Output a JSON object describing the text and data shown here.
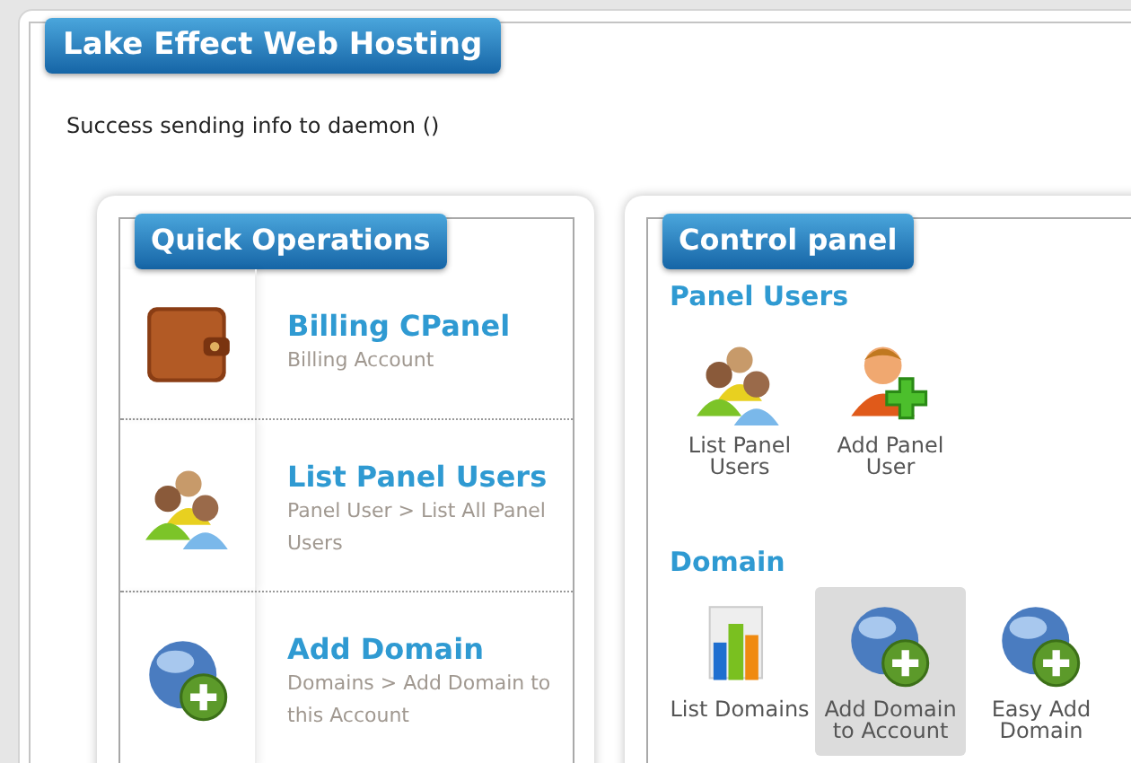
{
  "page_title": "Lake Effect Web Hosting",
  "message": "Success sending info to daemon ()",
  "quick_operations": {
    "title": "Quick Operations",
    "items": [
      {
        "kind": "wallet",
        "title": "Billing CPanel",
        "subtitle": "Billing Account"
      },
      {
        "kind": "users",
        "title": "List Panel Users",
        "subtitle": "Panel User > List All Panel Users"
      },
      {
        "kind": "globe-add",
        "title": "Add Domain",
        "subtitle": "Domains > Add Domain to this Account"
      }
    ]
  },
  "control_panel": {
    "title": "Control panel",
    "sections": [
      {
        "heading": "Panel Users",
        "items": [
          {
            "kind": "users",
            "label": "List Panel Users",
            "selected": false
          },
          {
            "kind": "user-add",
            "label": "Add Panel User",
            "selected": false
          }
        ]
      },
      {
        "heading": "Domain",
        "items": [
          {
            "kind": "chart",
            "label": "List Domains",
            "selected": false
          },
          {
            "kind": "globe-add",
            "label": "Add Domain to Account",
            "selected": true
          },
          {
            "kind": "globe-add",
            "label": "Easy Add Domain",
            "selected": false
          }
        ]
      }
    ]
  }
}
